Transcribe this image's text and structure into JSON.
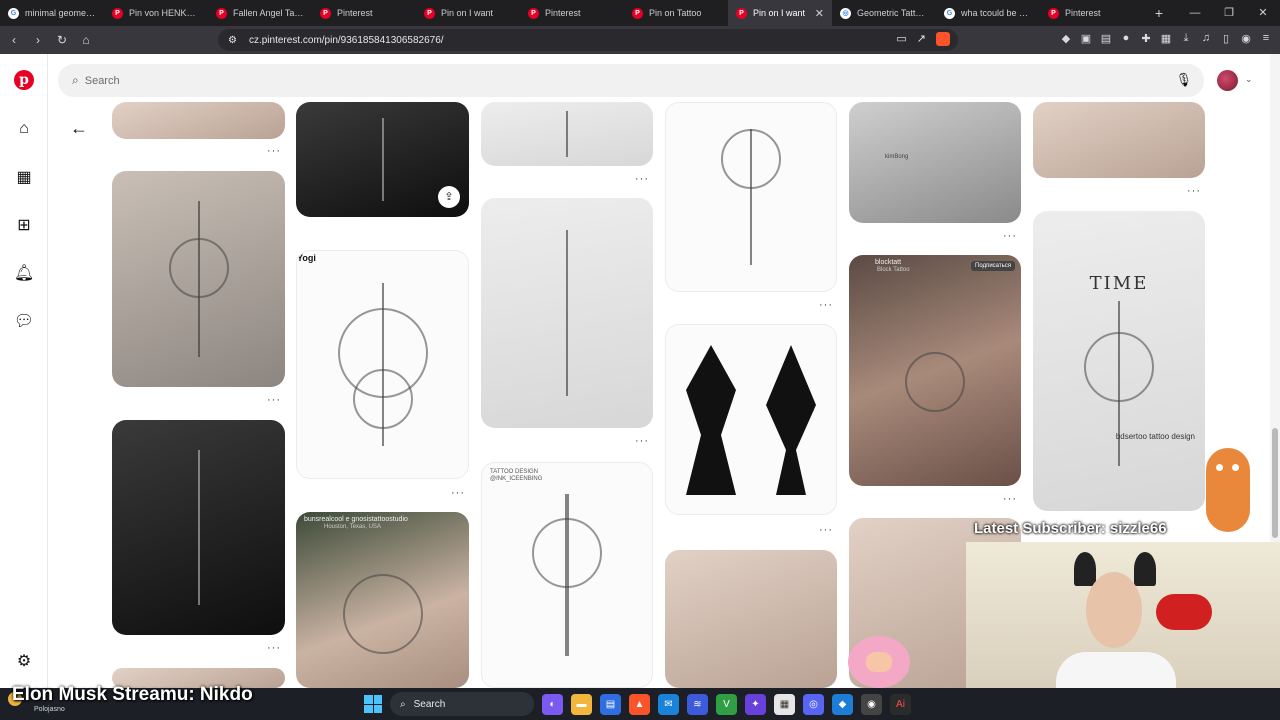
{
  "browser": {
    "tabs": [
      {
        "label": "minimal geometric",
        "icon": "google-icon",
        "active": false
      },
      {
        "label": "Pin von HENKO auf",
        "icon": "pinterest-icon",
        "active": false
      },
      {
        "label": "Fallen Angel Tattoo",
        "icon": "pinterest-icon",
        "active": false
      },
      {
        "label": "Pinterest",
        "icon": "pinterest-icon",
        "active": false
      },
      {
        "label": "Pin on I want",
        "icon": "pinterest-icon",
        "active": false
      },
      {
        "label": "Pinterest",
        "icon": "pinterest-icon",
        "active": false
      },
      {
        "label": "Pin on Tattoo",
        "icon": "pinterest-icon",
        "active": false
      },
      {
        "label": "Pin on I want",
        "icon": "pinterest-icon",
        "active": true
      },
      {
        "label": "Geometric Tattoo G",
        "icon": "globe-icon",
        "active": false
      },
      {
        "label": "wha tcould be mea",
        "icon": "google-icon",
        "active": false
      },
      {
        "label": "Pinterest",
        "icon": "pinterest-icon",
        "active": false
      }
    ],
    "url": "cz.pinterest.com/pin/936185841306582676/"
  },
  "pinterest": {
    "search_placeholder": "Search",
    "brand_color": "#e60023",
    "rail_icons": [
      "home-icon",
      "explore-icon",
      "create-icon",
      "notifications-icon",
      "messages-icon",
      "settings-icon"
    ],
    "pins": {
      "p5_caption": "bunsrealcool e gnosistattoostudio",
      "p5_sub": "Houston, Texas, USA",
      "p7_caption": "TATTOO DESIGN",
      "p7_sub": "@INK_ICEENBING",
      "p11_caption": "blocktatt",
      "p11_sub": "Block Tattoo",
      "p11_button": "Подписаться",
      "p4_tag": "Yogi",
      "p13_title": "TIME",
      "p13_handle": "bdsertoo  tattoo design",
      "p10_tag": "kimBong"
    }
  },
  "stream": {
    "latest_subscriber": "Latest Subscriber: sizzle66",
    "ticker": "Elon Musk Streamu: Nikdo"
  },
  "taskbar": {
    "weather": "Polojasno",
    "search_label": "Search"
  }
}
